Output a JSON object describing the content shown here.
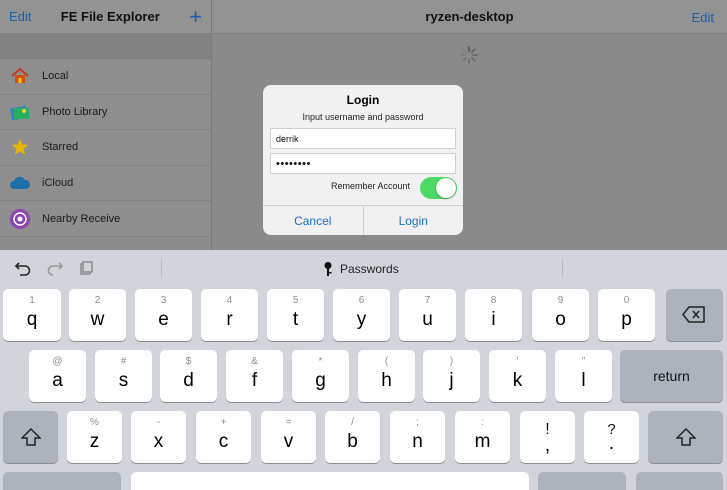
{
  "sidebar": {
    "edit_label": "Edit",
    "title": "FE File Explorer",
    "add_label": "+",
    "items": [
      {
        "label": "Local",
        "icon": "home-icon"
      },
      {
        "label": "Photo Library",
        "icon": "photo-library-icon"
      },
      {
        "label": "Starred",
        "icon": "star-icon"
      },
      {
        "label": "iCloud",
        "icon": "cloud-icon"
      },
      {
        "label": "Nearby Receive",
        "icon": "nearby-receive-icon"
      }
    ]
  },
  "main": {
    "title": "ryzen-desktop",
    "edit_label": "Edit"
  },
  "dialog": {
    "title": "Login",
    "message": "Input username and password",
    "username_value": "derrik",
    "password_value": "••••••••",
    "remember_label": "Remember Account",
    "remember_on": true,
    "cancel_label": "Cancel",
    "login_label": "Login"
  },
  "keyboard": {
    "passwords_label": "Passwords",
    "row1": [
      {
        "hint": "1",
        "ch": "q"
      },
      {
        "hint": "2",
        "ch": "w"
      },
      {
        "hint": "3",
        "ch": "e"
      },
      {
        "hint": "4",
        "ch": "r"
      },
      {
        "hint": "5",
        "ch": "t"
      },
      {
        "hint": "6",
        "ch": "y"
      },
      {
        "hint": "7",
        "ch": "u"
      },
      {
        "hint": "8",
        "ch": "i"
      },
      {
        "hint": "9",
        "ch": "o"
      },
      {
        "hint": "0",
        "ch": "p"
      }
    ],
    "row2": [
      {
        "hint": "@",
        "ch": "a"
      },
      {
        "hint": "#",
        "ch": "s"
      },
      {
        "hint": "$",
        "ch": "d"
      },
      {
        "hint": "&",
        "ch": "f"
      },
      {
        "hint": "*",
        "ch": "g"
      },
      {
        "hint": "(",
        "ch": "h"
      },
      {
        "hint": ")",
        "ch": "j"
      },
      {
        "hint": "'",
        "ch": "k"
      },
      {
        "hint": "\"",
        "ch": "l"
      }
    ],
    "return_label": "return",
    "row3": [
      {
        "hint": "%",
        "ch": "z"
      },
      {
        "hint": "-",
        "ch": "x"
      },
      {
        "hint": "+",
        "ch": "c"
      },
      {
        "hint": "=",
        "ch": "v"
      },
      {
        "hint": "/",
        "ch": "b"
      },
      {
        "hint": ";",
        "ch": "n"
      },
      {
        "hint": ":",
        "ch": "m"
      },
      {
        "hint": "!",
        "ch": ","
      },
      {
        "hint": "?",
        "ch": "."
      }
    ]
  },
  "colors": {
    "accent": "#1a6fd4",
    "toggle_on": "#4cd964"
  }
}
